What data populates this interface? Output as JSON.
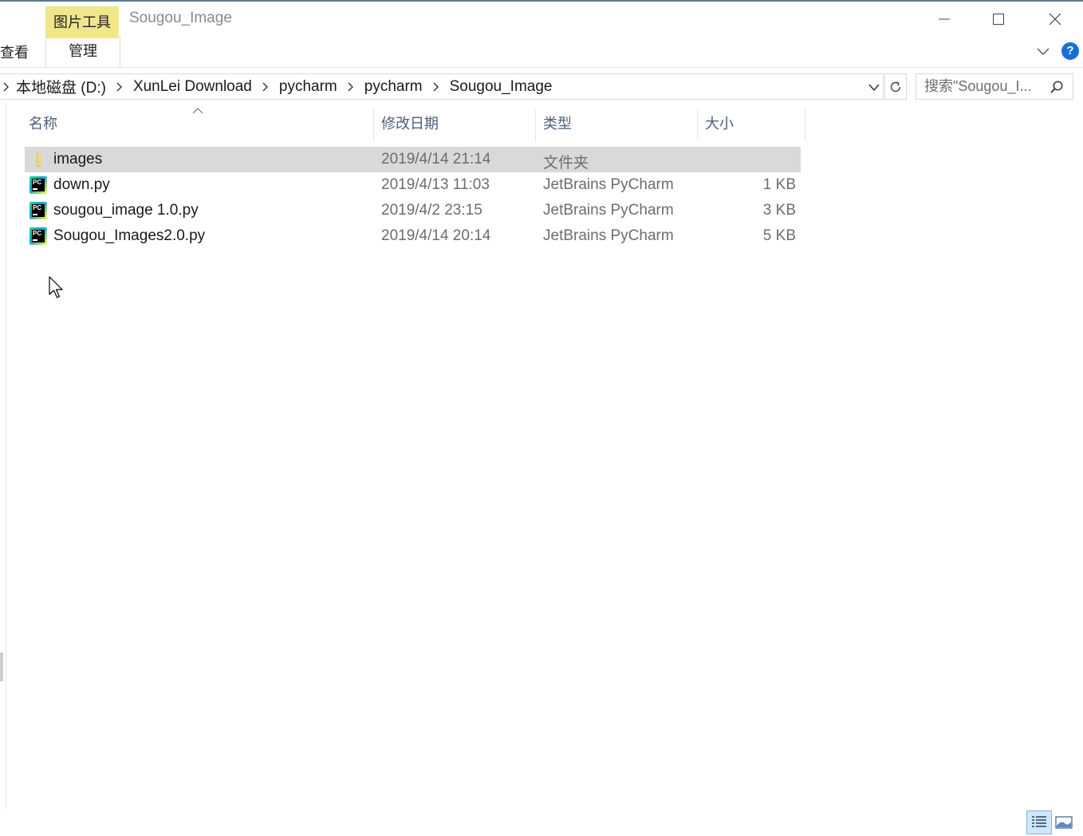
{
  "window": {
    "tool_tab": "图片工具",
    "title": "Sougou_Image"
  },
  "ribbon": {
    "view_tab": "查看",
    "manage_tab": "管理"
  },
  "address": {
    "breadcrumbs": [
      "本地磁盘 (D:)",
      "XunLei Download",
      "pycharm",
      "pycharm",
      "Sougou_Image"
    ]
  },
  "search": {
    "placeholder": "搜索\"Sougou_I..."
  },
  "columns": {
    "name": "名称",
    "date": "修改日期",
    "type": "类型",
    "size": "大小"
  },
  "files": [
    {
      "name": "images",
      "date": "2019/4/14 21:14",
      "type": "文件夹",
      "size": "",
      "icon": "folder-icon",
      "selected": true
    },
    {
      "name": "down.py",
      "date": "2019/4/13 11:03",
      "type": "JetBrains PyCharm",
      "size": "1 KB",
      "icon": "pycharm-file-icon",
      "selected": false
    },
    {
      "name": "sougou_image 1.0.py",
      "date": "2019/4/2 23:15",
      "type": "JetBrains PyCharm",
      "size": "3 KB",
      "icon": "pycharm-file-icon",
      "selected": false
    },
    {
      "name": "Sougou_Images2.0.py",
      "date": "2019/4/14 20:14",
      "type": "JetBrains PyCharm",
      "size": "5 KB",
      "icon": "pycharm-file-icon",
      "selected": false
    }
  ],
  "colors": {
    "tool_tab": "#f0e68c",
    "selection": "#d9d9d9",
    "header_text": "#4c607a",
    "help_blue": "#1a6fd4"
  }
}
